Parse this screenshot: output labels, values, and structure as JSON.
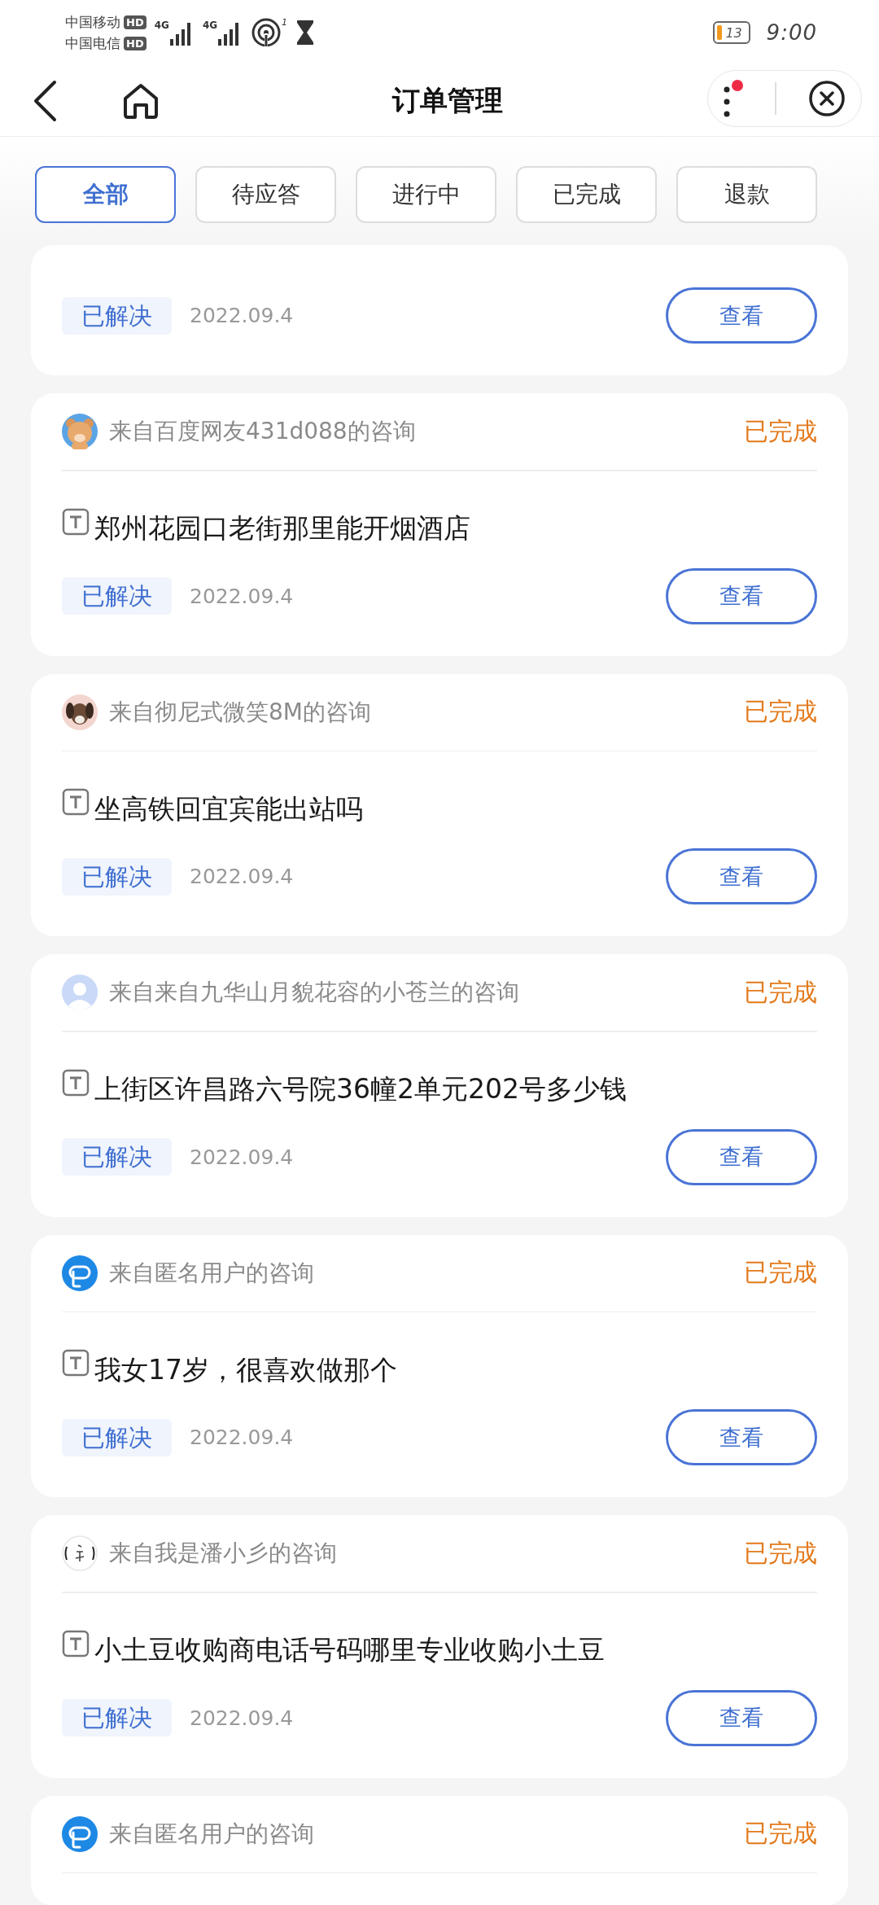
{
  "status_bar": {
    "carriers": [
      {
        "name": "中国移动",
        "badge": "HD",
        "network": "4G"
      },
      {
        "name": "中国电信",
        "badge": "HD",
        "network": "4G"
      }
    ],
    "hotspot_count": "1",
    "battery": "13",
    "time": "9:00"
  },
  "nav_bar": {
    "title": "订单管理",
    "menu_badge": true
  },
  "tabs": [
    {
      "label": "全部",
      "selected": true
    },
    {
      "label": "待应答",
      "selected": false
    },
    {
      "label": "进行中",
      "selected": false
    },
    {
      "label": "已完成",
      "selected": false
    },
    {
      "label": "退款",
      "selected": false
    }
  ],
  "orders": [
    {
      "kind": "partial",
      "tag": "已解决",
      "date": "2022.09.4",
      "button": "查看"
    },
    {
      "kind": "full",
      "avatar": {
        "kind": "bear"
      },
      "from": "来自百度网友431d088的咨询",
      "status": "已完成",
      "question": "郑州花园口老街那里能开烟酒店",
      "tag": "已解决",
      "date": "2022.09.4",
      "button": "查看"
    },
    {
      "kind": "full",
      "avatar": {
        "kind": "dog"
      },
      "from": "来自彻尼式微笑8M的咨询",
      "status": "已完成",
      "question": "坐高铁回宜宾能出站吗",
      "tag": "已解决",
      "date": "2022.09.4",
      "button": "查看"
    },
    {
      "kind": "full",
      "avatar": {
        "kind": "person"
      },
      "from": "来自来自九华山月貌花容的小苍兰的咨询",
      "status": "已完成",
      "question": "上街区许昌路六号院36幢2单元202号多少钱",
      "tag": "已解决",
      "date": "2022.09.4",
      "button": "查看"
    },
    {
      "kind": "full",
      "avatar": {
        "kind": "anonymous"
      },
      "from": "来自匿名用户的咨询",
      "status": "已完成",
      "question": "我女17岁，很喜欢做那个",
      "tag": "已解决",
      "date": "2022.09.4",
      "button": "查看"
    },
    {
      "kind": "full",
      "avatar": {
        "kind": "brush"
      },
      "from": "来自我是潘小彡的咨询",
      "status": "已完成",
      "question": "小土豆收购商电话号码哪里专业收购小土豆",
      "tag": "已解决",
      "date": "2022.09.4",
      "button": "查看"
    },
    {
      "kind": "header_only",
      "avatar": {
        "kind": "anonymous"
      },
      "from": "来自匿名用户的咨询",
      "status": "已完成"
    }
  ]
}
